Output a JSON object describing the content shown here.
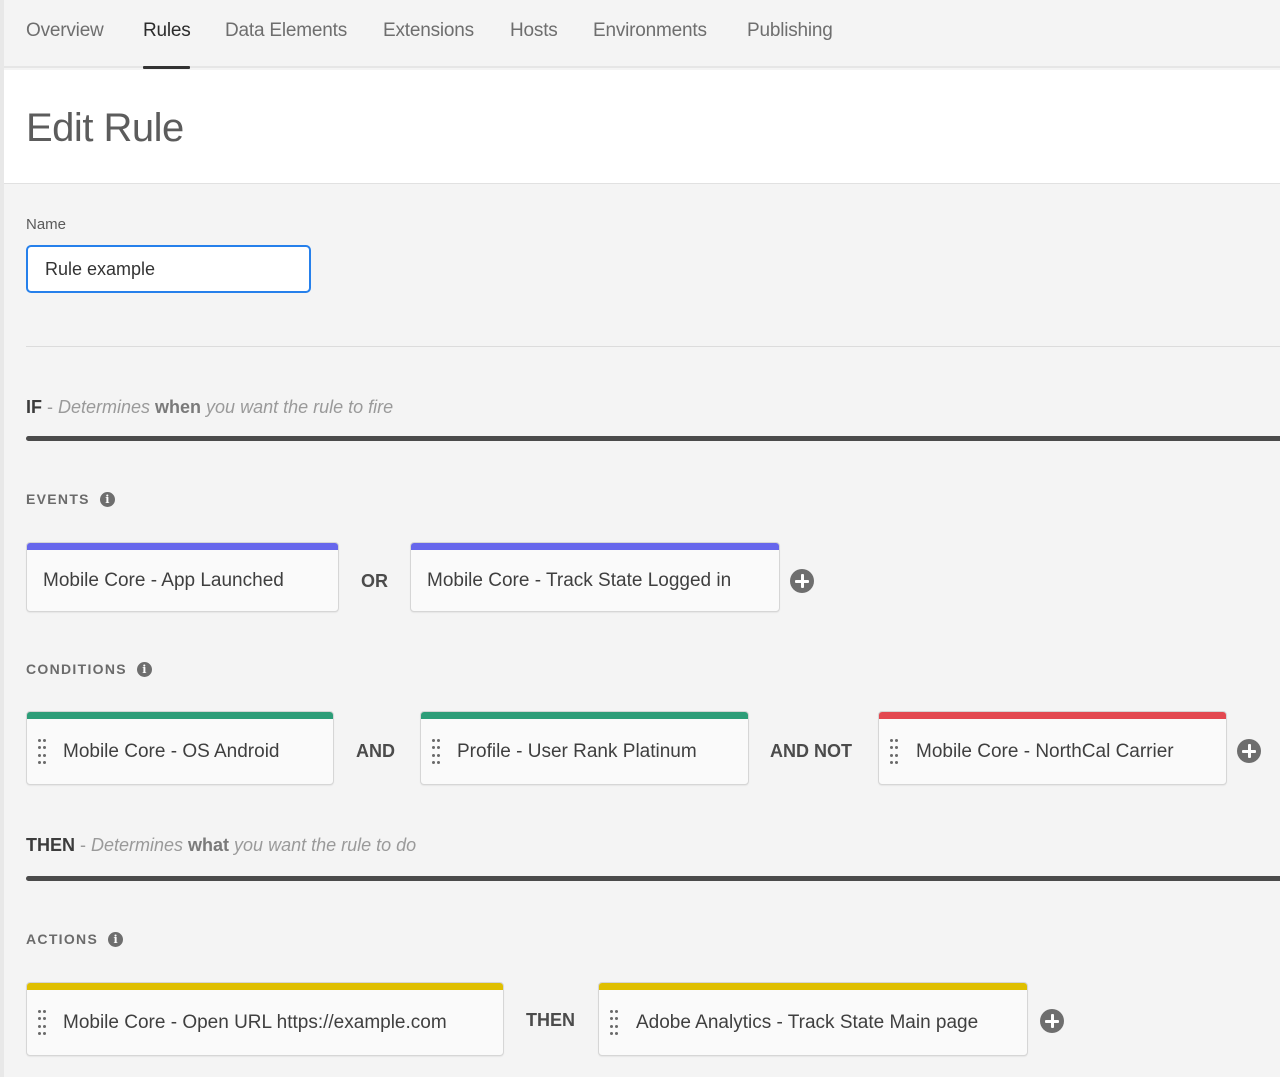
{
  "nav": {
    "tabs": [
      {
        "label": "Overview",
        "active": false
      },
      {
        "label": "Rules",
        "active": true
      },
      {
        "label": "Data Elements",
        "active": false
      },
      {
        "label": "Extensions",
        "active": false
      },
      {
        "label": "Hosts",
        "active": false
      },
      {
        "label": "Environments",
        "active": false
      },
      {
        "label": "Publishing",
        "active": false
      }
    ]
  },
  "header": {
    "title": "Edit Rule"
  },
  "form": {
    "name_label": "Name",
    "name_value": "Rule example"
  },
  "if_section": {
    "keyword": "IF",
    "separator": " - ",
    "desc_pre": "Determines ",
    "desc_em": "when",
    "desc_post": " you want the rule to fire"
  },
  "events": {
    "label": "EVENTS",
    "info_icon": "info-icon",
    "color": "#6767ec",
    "items": [
      {
        "label": "Mobile Core - App Launched"
      },
      {
        "label": "Mobile Core - Track State Logged in"
      }
    ],
    "operators": [
      "OR"
    ]
  },
  "conditions": {
    "label": "CONDITIONS",
    "info_icon": "info-icon",
    "items": [
      {
        "label": "Mobile Core - OS Android",
        "color": "#2d9d78"
      },
      {
        "label": "Profile - User Rank Platinum",
        "color": "#2d9d78"
      },
      {
        "label": "Mobile Core - NorthCal Carrier",
        "color": "#e34850"
      }
    ],
    "operators": [
      "AND",
      "AND NOT"
    ]
  },
  "then_section": {
    "keyword": "THEN",
    "separator": " - ",
    "desc_pre": "Determines ",
    "desc_em": "what",
    "desc_post": " you want the rule to do"
  },
  "actions": {
    "label": "ACTIONS",
    "info_icon": "info-icon",
    "color": "#dfbf00",
    "items": [
      {
        "label": "Mobile Core - Open URL https://example.com"
      },
      {
        "label": "Adobe Analytics - Track State Main page"
      }
    ],
    "operators": [
      "THEN"
    ]
  },
  "icons": {
    "add": "plus-circle-icon",
    "drag": "drag-handle-icon",
    "info": "info-icon"
  },
  "info_glyph": "i"
}
